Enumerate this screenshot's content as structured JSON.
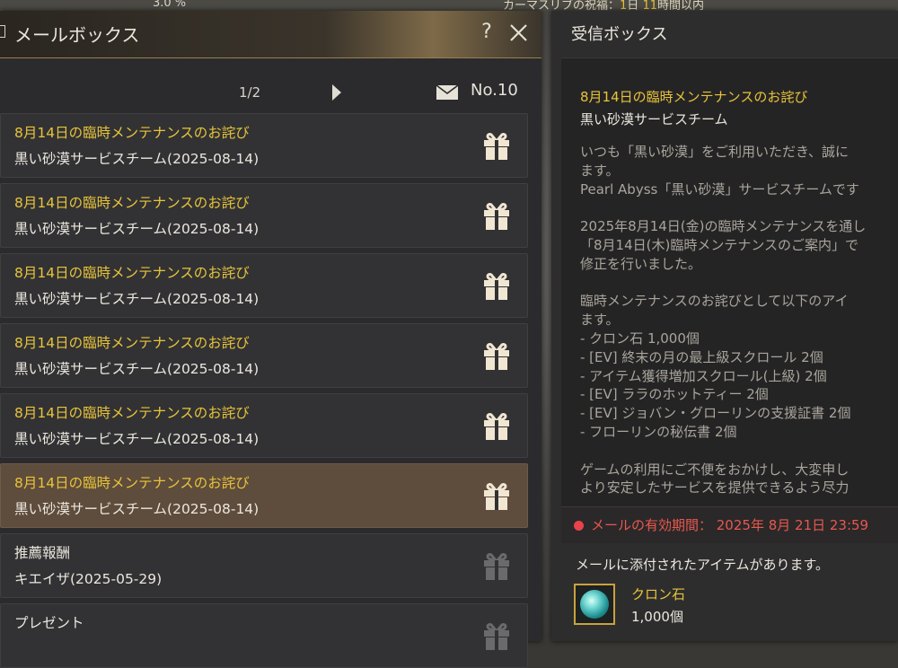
{
  "top_strip": {
    "percent": "3.0 %",
    "notice_pre": "カーマスリブの祝福：",
    "notice_hl1": "1",
    "notice_mid": "日 ",
    "notice_hl2": "11",
    "notice_post": "時間以内"
  },
  "mailbox": {
    "title": "メールボックス",
    "help": "?",
    "page": "1/2",
    "count": "No.10",
    "items": [
      {
        "subject": "8月14日の臨時メンテナンスのお詫び",
        "sender": "黒い砂漠サービスチーム(2025-08-14)",
        "selected": false,
        "gift": "gift-icon-active"
      },
      {
        "subject": "8月14日の臨時メンテナンスのお詫び",
        "sender": "黒い砂漠サービスチーム(2025-08-14)",
        "selected": false,
        "gift": "gift-icon-active"
      },
      {
        "subject": "8月14日の臨時メンテナンスのお詫び",
        "sender": "黒い砂漠サービスチーム(2025-08-14)",
        "selected": false,
        "gift": "gift-icon-active"
      },
      {
        "subject": "8月14日の臨時メンテナンスのお詫び",
        "sender": "黒い砂漠サービスチーム(2025-08-14)",
        "selected": false,
        "gift": "gift-icon-active"
      },
      {
        "subject": "8月14日の臨時メンテナンスのお詫び",
        "sender": "黒い砂漠サービスチーム(2025-08-14)",
        "selected": false,
        "gift": "gift-icon-active"
      },
      {
        "subject": "8月14日の臨時メンテナンスのお詫び",
        "sender": "黒い砂漠サービスチーム(2025-08-14)",
        "selected": true,
        "gift": "gift-icon-active"
      },
      {
        "subject": "推薦報酬",
        "sender": "キエイザ(2025-05-29)",
        "selected": false,
        "gift": "gift-icon-claimed"
      },
      {
        "subject": "プレゼント",
        "sender": "",
        "selected": false,
        "gift": "gift-icon-claimed"
      }
    ]
  },
  "inbox": {
    "title": "受信ボックス",
    "subject": "8月14日の臨時メンテナンスのお詫び",
    "sender": "黒い砂漠サービスチーム",
    "body": "いつも「黒い砂漠」をご利用いただき、誠に\nます。\nPearl Abyss「黒い砂漠」サービスチームです\n\n2025年8月14日(金)の臨時メンテナンスを通し\n「8月14日(木)臨時メンテナンスのご案内」で\n修正を行いました。\n\n臨時メンテナンスのお詫びとして以下のアイ\nます。\n- クロン石 1,000個\n- [EV] 終末の月の最上級スクロール 2個\n- アイテム獲得増加スクロール(上級) 2個\n- [EV] ララのホットティー 2個\n- [EV] ジョバン・グローリンの支援証書 2個\n- フローリンの秘伝書 2個\n\nゲームの利用にご不便をおかけし、大変申し\nより安定したサービスを提供できるよう尽力",
    "expiry": "メールの有効期間： 2025年 8月 21日 23:59",
    "attach_label": "メールに添付されたアイテムがあります。",
    "attachment": {
      "name": "クロン石",
      "qty": "1,000個",
      "icon": "cron-stone-icon"
    }
  },
  "colors": {
    "accent_yellow": "#e8c43a",
    "expiry_red": "#e8584e",
    "selected_row": "#5e4c3c",
    "header_gold": "#9a7f4c"
  }
}
